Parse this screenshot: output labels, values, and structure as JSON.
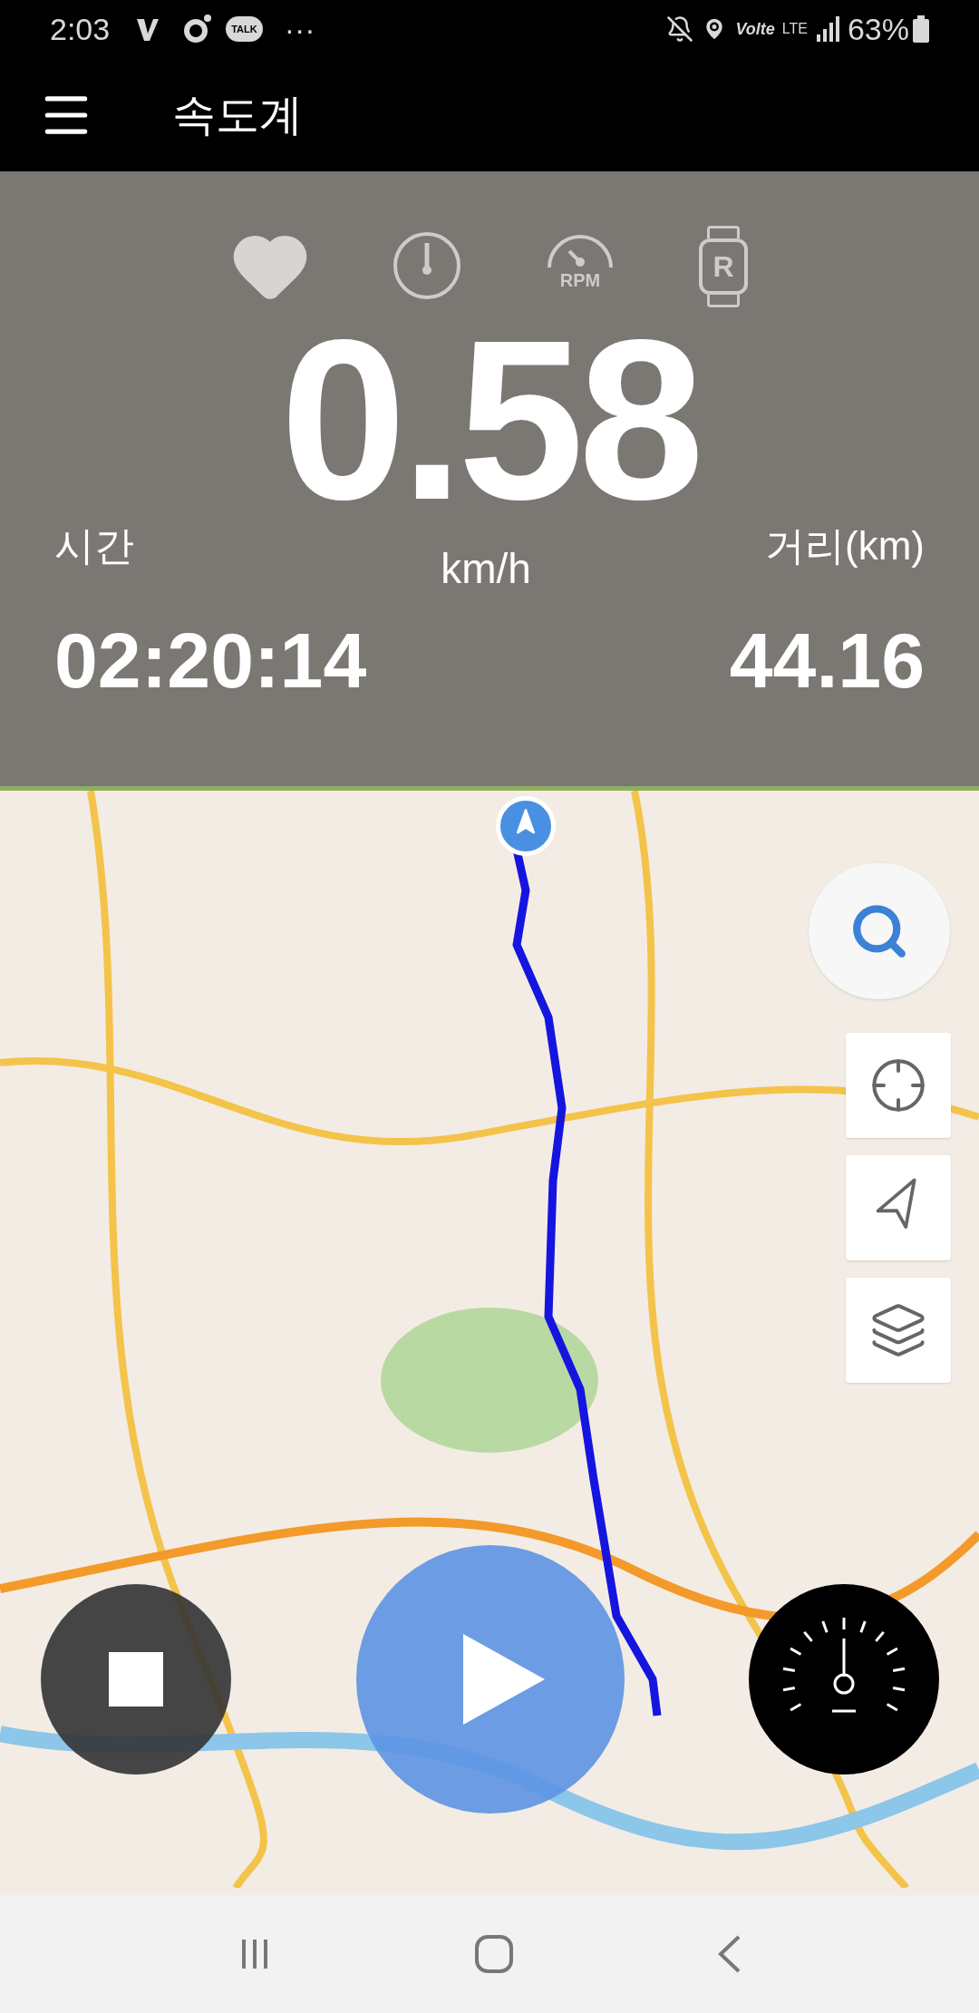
{
  "status_bar": {
    "time": "2:03",
    "chat_badge": "TALK",
    "more": "···",
    "volte": "Volte",
    "network": "LTE",
    "battery_percent": "63%"
  },
  "app_bar": {
    "title": "속도계"
  },
  "sensors": {
    "rpm_label": "RPM",
    "watch_letter": "R"
  },
  "speed": {
    "value": "0.58",
    "unit": "km/h"
  },
  "time": {
    "label": "시간",
    "value": "02:20:14"
  },
  "distance": {
    "label": "거리(km)",
    "value": "44.16"
  }
}
